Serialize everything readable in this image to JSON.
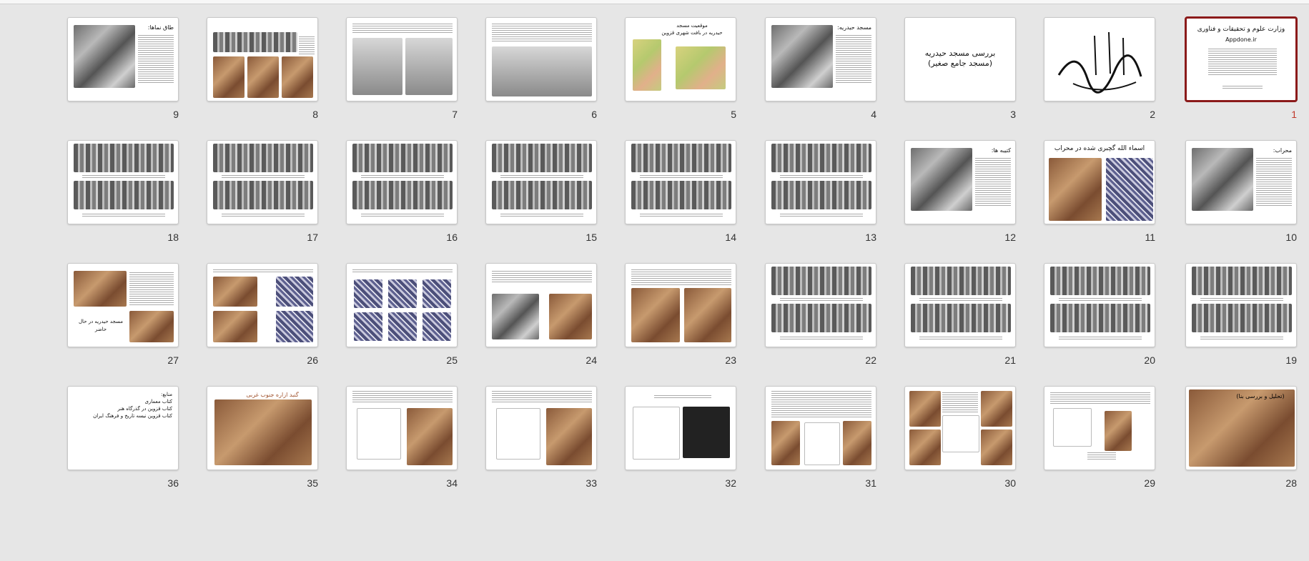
{
  "slides": [
    {
      "n": "1",
      "kind": "title",
      "selected": true,
      "lines": [
        "وزارت علوم و تحقیقات و فناوری",
        "Appdone.ir"
      ]
    },
    {
      "n": "2",
      "kind": "calligraphy"
    },
    {
      "n": "3",
      "kind": "heading",
      "lines": [
        "بررسی مسجد حیدریه",
        "(مسجد جامع صغیر)"
      ]
    },
    {
      "n": "4",
      "kind": "photo-text",
      "title": "مسجد حیدریه:"
    },
    {
      "n": "5",
      "kind": "maps",
      "title": "موقعیت مسجد",
      "subtitle": "حیدریه در بافت شهری قزوین"
    },
    {
      "n": "6",
      "kind": "photo-wide"
    },
    {
      "n": "7",
      "kind": "photo-two"
    },
    {
      "n": "8",
      "kind": "photo-three"
    },
    {
      "n": "9",
      "kind": "photo-text",
      "title": "طاق نماها:"
    },
    {
      "n": "10",
      "kind": "photo-text",
      "title": "محراب:"
    },
    {
      "n": "11",
      "kind": "mihrab",
      "title": "اسماء الله گچبری شده در محراب"
    },
    {
      "n": "12",
      "kind": "photo-text",
      "title": "کتیبه ها:"
    },
    {
      "n": "13",
      "kind": "inscription"
    },
    {
      "n": "14",
      "kind": "inscription"
    },
    {
      "n": "15",
      "kind": "inscription"
    },
    {
      "n": "16",
      "kind": "inscription"
    },
    {
      "n": "17",
      "kind": "inscription"
    },
    {
      "n": "18",
      "kind": "inscription"
    },
    {
      "n": "19",
      "kind": "inscription"
    },
    {
      "n": "20",
      "kind": "inscription"
    },
    {
      "n": "21",
      "kind": "inscription"
    },
    {
      "n": "22",
      "kind": "inscription"
    },
    {
      "n": "23",
      "kind": "photo-two-dark"
    },
    {
      "n": "24",
      "kind": "circle-arrow"
    },
    {
      "n": "25",
      "kind": "pattern-grid"
    },
    {
      "n": "26",
      "kind": "pattern-arrows"
    },
    {
      "n": "27",
      "kind": "exterior",
      "caption": "مسجد حیدریه در حال حاضر"
    },
    {
      "n": "28",
      "kind": "photo-full",
      "title": "(تحلیل و بررسی بنا)"
    },
    {
      "n": "29",
      "kind": "plan-photo"
    },
    {
      "n": "30",
      "kind": "plan-collage"
    },
    {
      "n": "31",
      "kind": "plan-doors"
    },
    {
      "n": "32",
      "kind": "plan-two"
    },
    {
      "n": "33",
      "kind": "plan-lines"
    },
    {
      "n": "34",
      "kind": "plan-lines"
    },
    {
      "n": "35",
      "kind": "brick",
      "title": "گنبد ازاره جنوب غربی"
    },
    {
      "n": "36",
      "kind": "sources",
      "lines": [
        "منابع:",
        "کتاب معماری",
        "کتاب قزوین در گذرگاه هنر",
        "کتاب قزوین نیسه تاریخ و فرهنگ ایران"
      ]
    }
  ]
}
